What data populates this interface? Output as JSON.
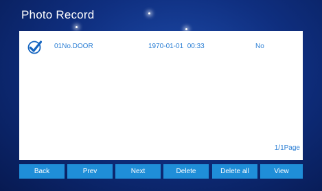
{
  "title": "Photo Record",
  "records": [
    {
      "selected": true,
      "device": "01No.DOOR",
      "time": "1970-01-01  00:33",
      "status": "No"
    }
  ],
  "pager": "1/1Page",
  "buttons": {
    "back": "Back",
    "prev": "Prev",
    "next": "Next",
    "delete": "Delete",
    "delete_all": "Delete all",
    "view": "View"
  },
  "colors": {
    "background": "#0f2f80",
    "panel": "#ffffff",
    "button": "#1f8ed8",
    "accent_text": "#2a7ed4",
    "check_icon": "#1565c0"
  },
  "icons": {
    "selected": "check-circle-icon"
  }
}
